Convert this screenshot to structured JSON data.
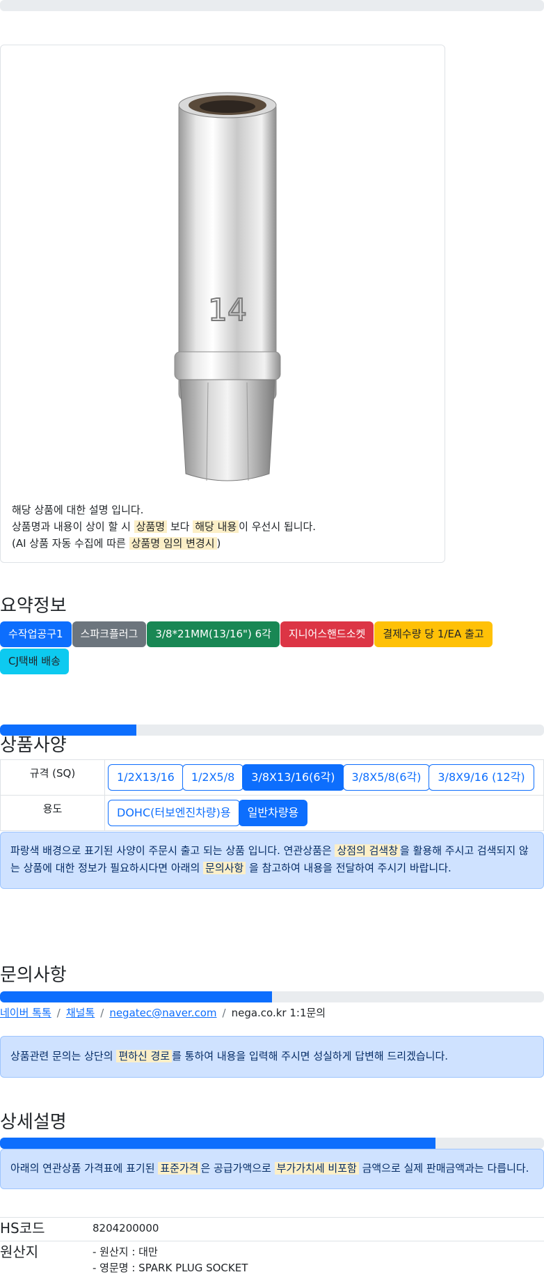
{
  "card": {
    "line1": "해당 상품에 대한 설명 입니다.",
    "line2_a": "상품명과 내용이 상이 할 시 ",
    "line2_mark1": "상품명",
    "line2_b": " 보다 ",
    "line2_mark2": "해당 내용",
    "line2_c": "이 우선시 됩니다.",
    "line3_a": "(AI 상품 자동 수집에 따른 ",
    "line3_mark": "상품명 임의 변경시",
    "line3_b": ")",
    "image_label": "14"
  },
  "summary": {
    "title": "요약정보",
    "badges": [
      {
        "label": "수작업공구1",
        "color": "blue"
      },
      {
        "label": "스파크플러그",
        "color": "gray"
      },
      {
        "label": "3/8*21MM(13/16\") 6각",
        "color": "green"
      },
      {
        "label": "지니어스핸드소켓",
        "color": "red"
      },
      {
        "label": "결제수량 당 1/EA 출고",
        "color": "yellow"
      },
      {
        "label": "CJ택배 배송",
        "color": "cyan"
      }
    ]
  },
  "progress": {
    "bar0": 0,
    "bar1": 0.25,
    "bar2": 0.5,
    "bar3": 0.8
  },
  "spec": {
    "title": "상품사양",
    "rows": [
      {
        "label": "규격 (SQ)",
        "options": [
          "1/2X13/16",
          "1/2X5/8",
          "3/8X13/16(6각)",
          "3/8X5/8(6각)",
          "3/8X9/16 (12각)"
        ],
        "active": "3/8X13/16(6각)"
      },
      {
        "label": "용도",
        "options": [
          "DOHC(터보엔진차량)용",
          "일반차량용"
        ],
        "active": "일반차량용"
      }
    ],
    "notice_a": "파랑색 배경으로 표기된 사양이 주문시 출고 되는 상품 입니다. 연관상품은 ",
    "notice_mark1": "상점의 검색창",
    "notice_b": "을 활용해 주시고 검색되지 않는 상품에 대한 정보가 필요하시다면 아래의 ",
    "notice_mark2": "문의사항",
    "notice_c": " 을 참고하여 내용을 전달하여 주시기 바랍니다."
  },
  "inquiry": {
    "title": "문의사항",
    "links": [
      "네이버 톡톡",
      "채널톡",
      "negatec@naver.com"
    ],
    "plain": "nega.co.kr 1:1문의",
    "sep": "/",
    "notice_a": "상품관련 문의는 상단의 ",
    "notice_mark": "편하신 경로",
    "notice_b": "를 통하여 내용을 입력해 주시면 성실하게 답변해 드리겠습니다."
  },
  "detail": {
    "title": "상세설명",
    "notice_a": "아래의 연관상품 가격표에 표기된 ",
    "notice_mark1": "표준가격",
    "notice_b": "은 공급가액으로 ",
    "notice_mark2": "부가가치세 비포함",
    "notice_c": " 금액으로 실제 판매금액과는 다릅니다.",
    "hs_label": "HS코드",
    "hs_value": "8204200000",
    "origin_label": "원산지",
    "origin_line1": "- 원산지 : 대만",
    "origin_line2": "- 영문명 : SPARK PLUG SOCKET"
  },
  "colors": {
    "primary": "#0d6efd",
    "alert_bg": "#cfe2ff",
    "mark_bg": "#fcefc7"
  }
}
